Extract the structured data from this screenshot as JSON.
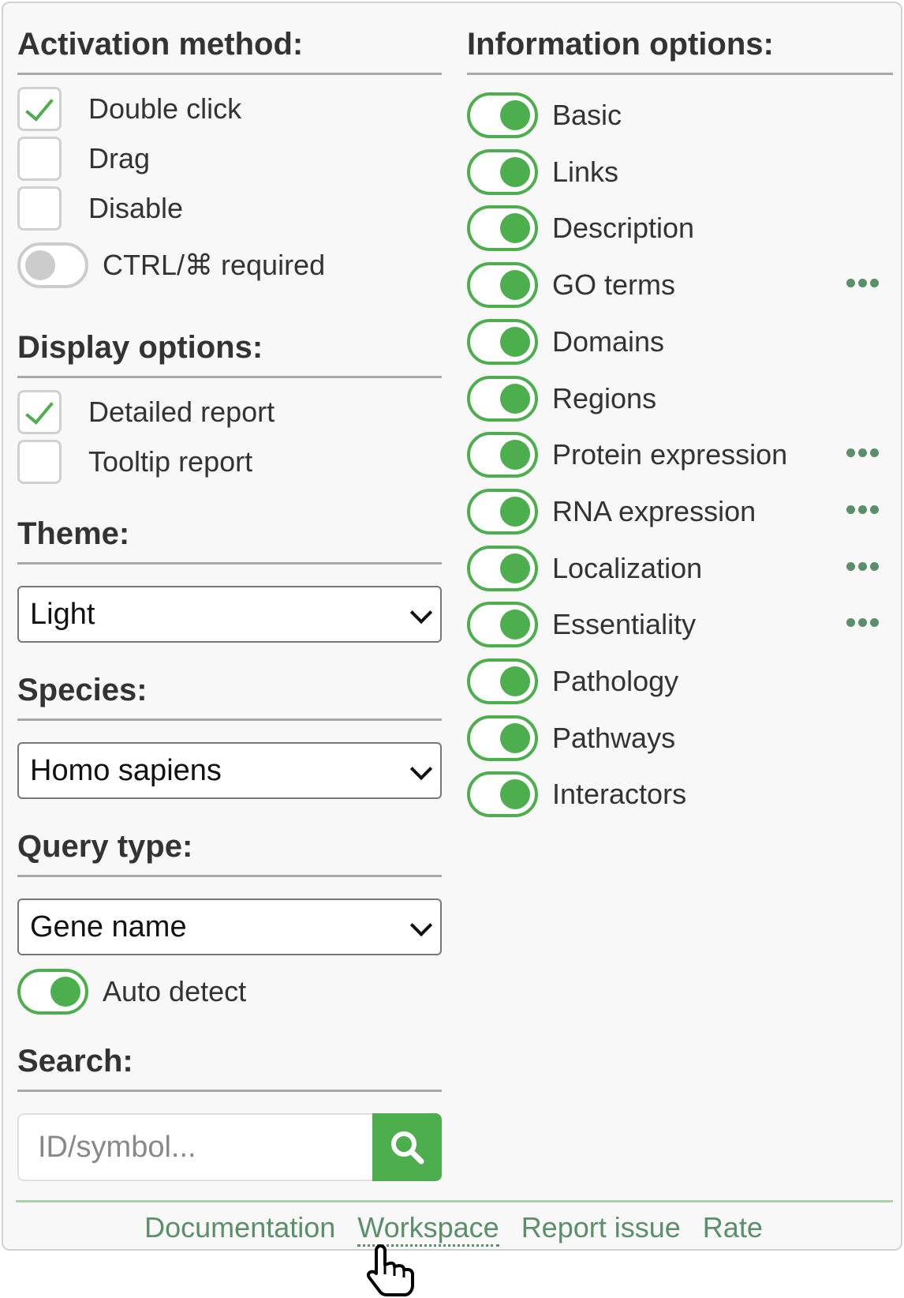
{
  "activation": {
    "heading": "Activation method:",
    "double_click": {
      "label": "Double click",
      "checked": true
    },
    "drag": {
      "label": "Drag",
      "checked": false
    },
    "disable": {
      "label": "Disable",
      "checked": false
    },
    "ctrl_required": {
      "label": "CTRL/⌘ required",
      "on": false
    }
  },
  "display": {
    "heading": "Display options:",
    "detailed": {
      "label": "Detailed report",
      "checked": true
    },
    "tooltip": {
      "label": "Tooltip report",
      "checked": false
    }
  },
  "theme": {
    "heading": "Theme:",
    "value": "Light"
  },
  "species": {
    "heading": "Species:",
    "value": "Homo sapiens"
  },
  "query": {
    "heading": "Query type:",
    "value": "Gene name",
    "auto_detect": {
      "label": "Auto detect",
      "on": true
    }
  },
  "search": {
    "heading": "Search:",
    "placeholder": "ID/symbol...",
    "button_icon": "search-icon"
  },
  "info": {
    "heading": "Information options:",
    "items": [
      {
        "label": "Basic",
        "on": true,
        "more": false
      },
      {
        "label": "Links",
        "on": true,
        "more": false
      },
      {
        "label": "Description",
        "on": true,
        "more": false
      },
      {
        "label": "GO terms",
        "on": true,
        "more": true
      },
      {
        "label": "Domains",
        "on": true,
        "more": false
      },
      {
        "label": "Regions",
        "on": true,
        "more": false
      },
      {
        "label": "Protein expression",
        "on": true,
        "more": true
      },
      {
        "label": "RNA expression",
        "on": true,
        "more": true
      },
      {
        "label": "Localization",
        "on": true,
        "more": true
      },
      {
        "label": "Essentiality",
        "on": true,
        "more": true
      },
      {
        "label": "Pathology",
        "on": true,
        "more": false
      },
      {
        "label": "Pathways",
        "on": true,
        "more": false
      },
      {
        "label": "Interactors",
        "on": true,
        "more": false
      }
    ]
  },
  "footer": {
    "documentation": "Documentation",
    "workspace": "Workspace",
    "report_issue": "Report issue",
    "rate": "Rate"
  },
  "colors": {
    "accent": "#4cae4c",
    "link": "#5a8f6a",
    "panel_bg": "#f8f8f8"
  }
}
